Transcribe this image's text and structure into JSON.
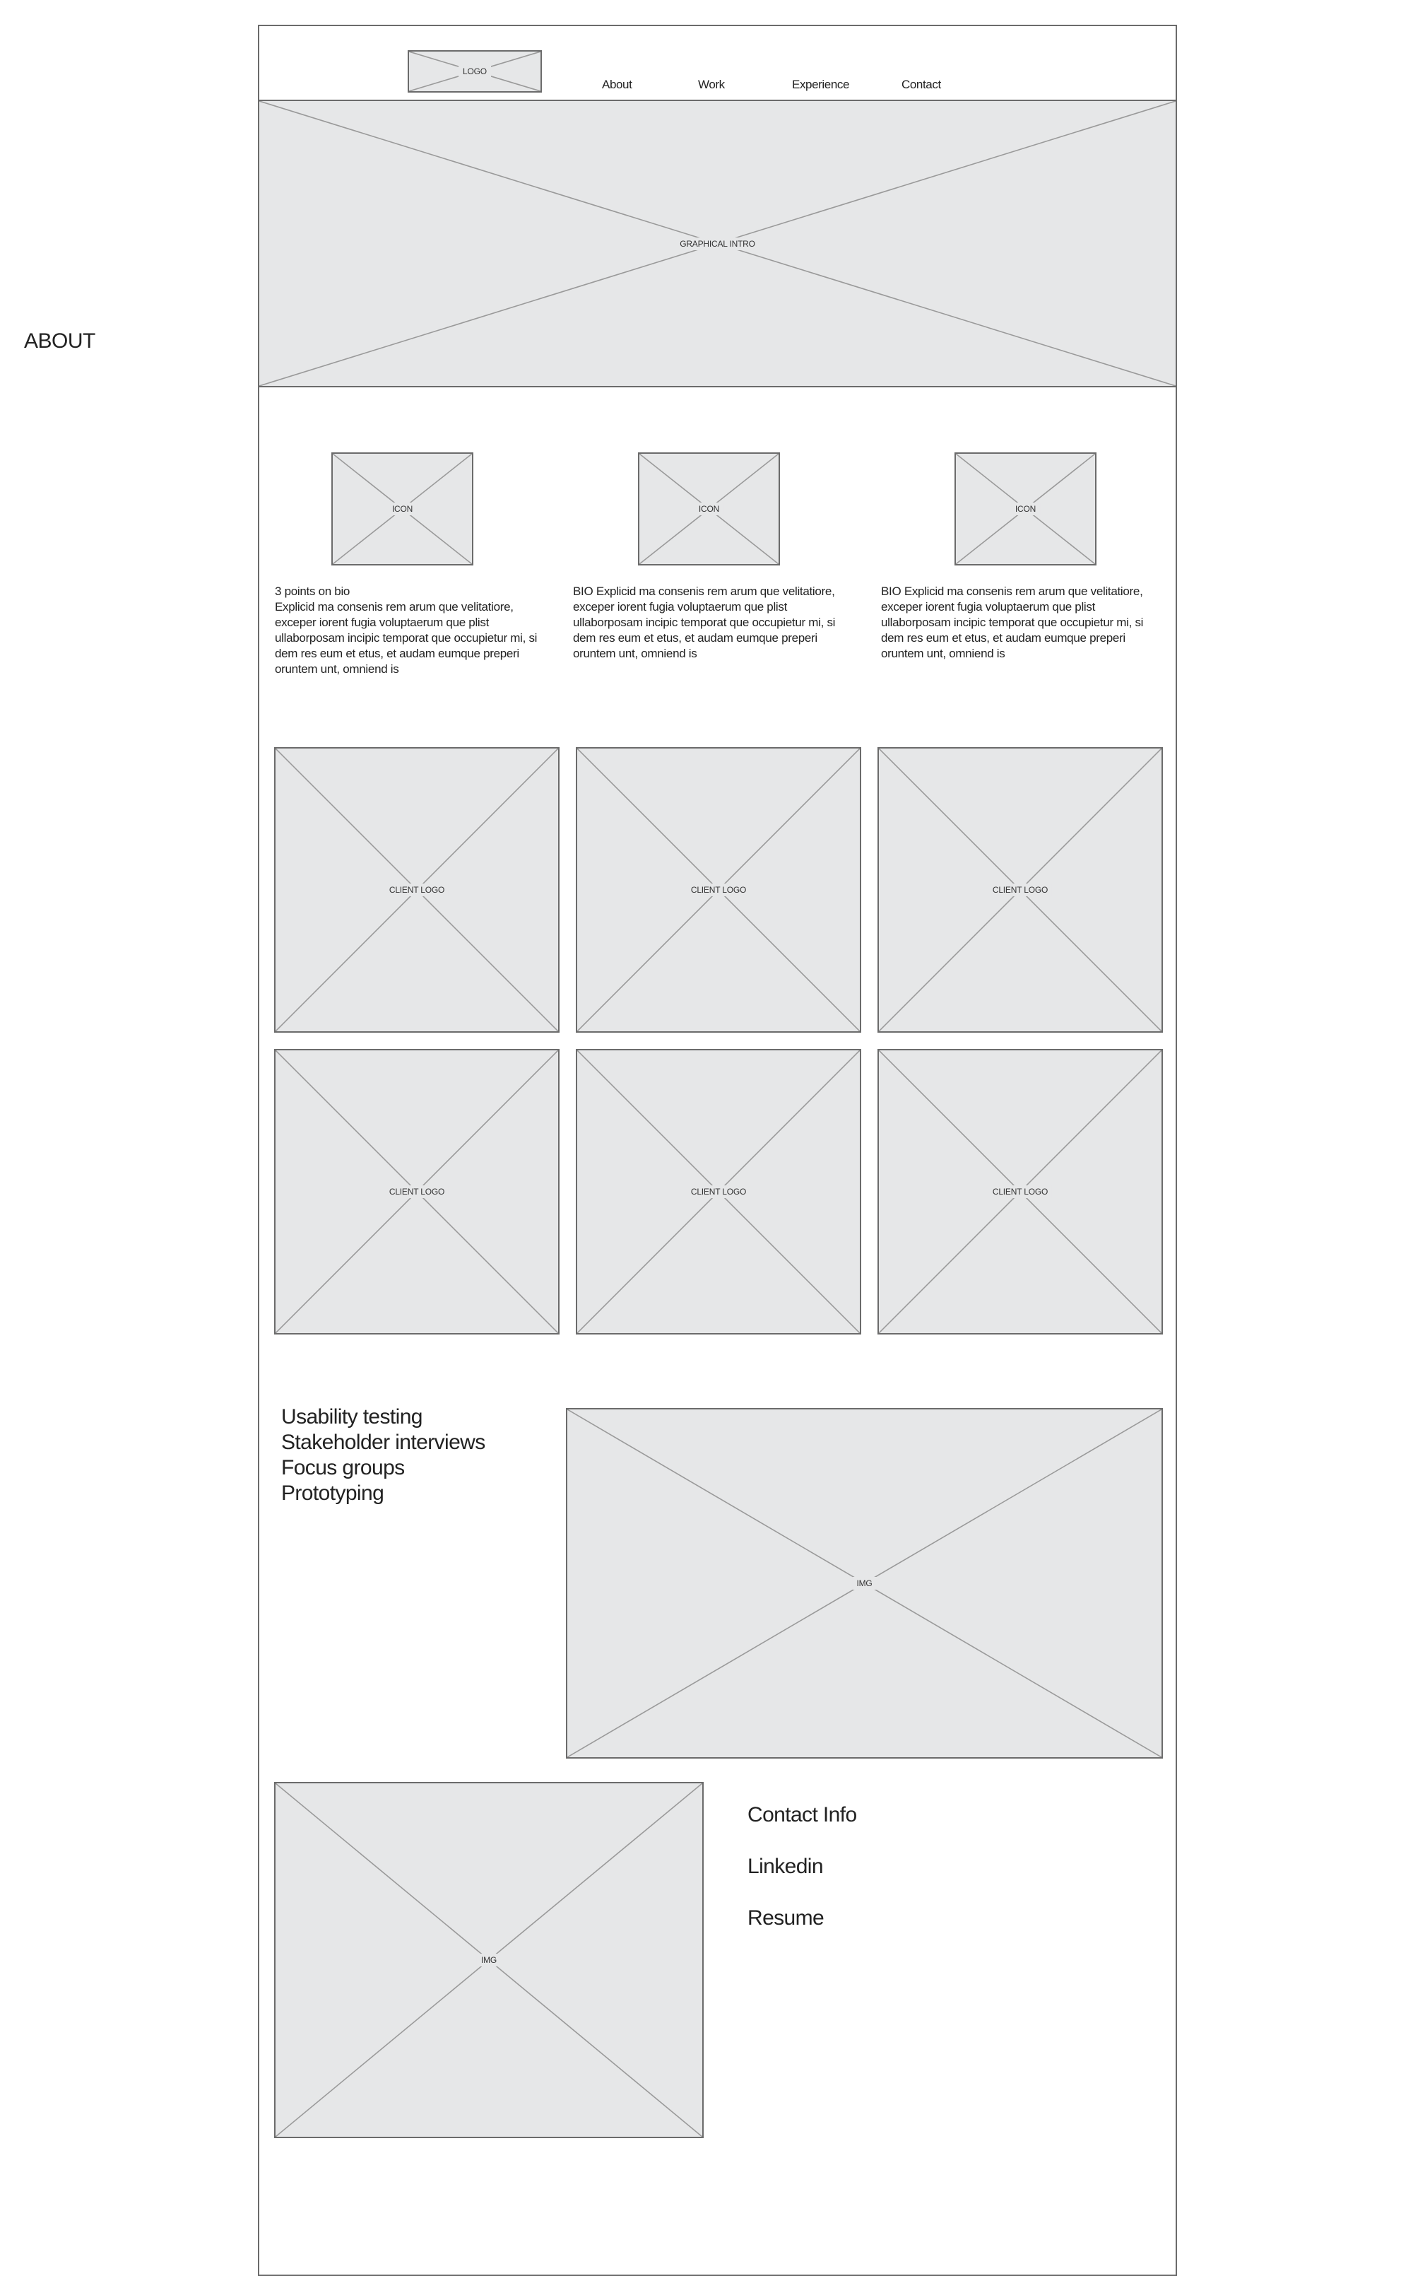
{
  "side_label": "ABOUT",
  "header": {
    "logo_label": "LOGO",
    "nav": [
      {
        "label": "About"
      },
      {
        "label": "Work"
      },
      {
        "label": "Experience"
      },
      {
        "label": "Contact"
      }
    ]
  },
  "hero": {
    "label": "GRAPHICAL INTRO"
  },
  "bio_columns": [
    {
      "icon_label": "ICON",
      "title": "3 points on bio",
      "text": "Explicid ma consenis rem arum que velitatiore, exceper iorent fugia voluptaerum que plist ullaborposam incipic temporat que occupietur mi, si dem res eum et etus, et audam eumque preperi oruntem unt, omniend is"
    },
    {
      "icon_label": "ICON",
      "title": "BIO",
      "text": "Explicid ma consenis rem arum que velitatiore, exceper iorent fugia voluptaerum que plist ullaborposam incipic temporat que occupietur mi, si dem res eum et etus, et audam eumque preperi oruntem unt, omniend is"
    },
    {
      "icon_label": "ICON",
      "title": "BIO",
      "text": "Explicid ma consenis rem arum que velitatiore, exceper iorent fugia voluptaerum que plist ullaborposam incipic temporat que occupietur mi, si dem res eum et etus, et audam eumque preperi oruntem unt, omniend is"
    }
  ],
  "client_logos": [
    {
      "label": "CLIENT LOGO"
    },
    {
      "label": "CLIENT LOGO"
    },
    {
      "label": "CLIENT LOGO"
    },
    {
      "label": "CLIENT LOGO"
    },
    {
      "label": "CLIENT LOGO"
    },
    {
      "label": "CLIENT LOGO"
    }
  ],
  "services": [
    "Usability testing",
    "Stakeholder interviews",
    "Focus groups",
    "Prototyping"
  ],
  "services_image": {
    "label": "IMG"
  },
  "contact_image": {
    "label": "IMG"
  },
  "contact": {
    "info": "Contact Info",
    "linkedin": "Linkedin",
    "resume": "Resume"
  }
}
